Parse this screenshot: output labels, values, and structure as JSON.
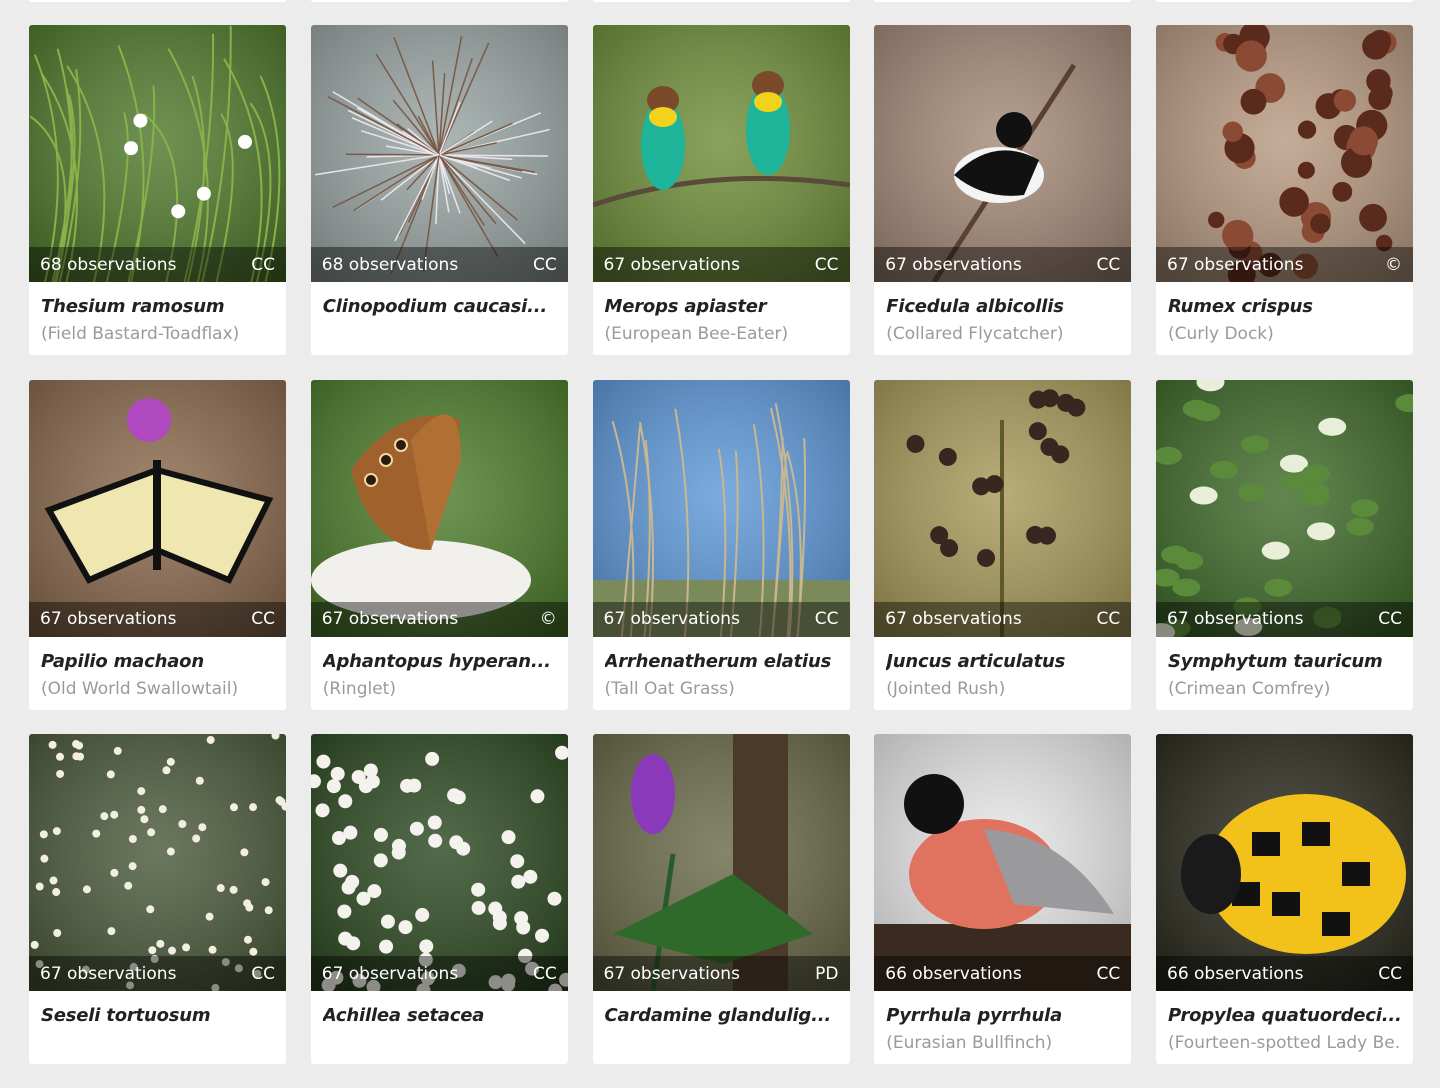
{
  "cards": [
    {
      "obs": "68 observations",
      "license": "CC",
      "sci": "Thesium ramosum",
      "common": "(Field Bastard-Toadflax)",
      "photo": "slender-green-stems-small-white-flowers",
      "bg": "#4f7a2c",
      "accent": "#ffffff"
    },
    {
      "obs": "68 observations",
      "license": "CC",
      "sci": "Clinopodium caucasi...",
      "common": "",
      "photo": "fluffy-white-seedhead",
      "bg": "#9aa6a4",
      "accent": "#e8e6ea"
    },
    {
      "obs": "67 observations",
      "license": "CC",
      "sci": "Merops apiaster",
      "common": "(European Bee-Eater)",
      "photo": "two-colorful-bee-eaters-on-branch",
      "bg": "#6f8f3a",
      "accent": "#1fb59a"
    },
    {
      "obs": "67 observations",
      "license": "CC",
      "sci": "Ficedula albicollis",
      "common": "(Collared Flycatcher)",
      "photo": "black-white-flycatcher-on-twig",
      "bg": "#a48a78",
      "accent": "#111111"
    },
    {
      "obs": "67 observations",
      "license": "©",
      "sci": "Rumex crispus",
      "common": "(Curly Dock)",
      "photo": "brown-dock-seed-cluster",
      "bg": "#b89a82",
      "accent": "#5a2a1c"
    },
    {
      "obs": "67 observations",
      "license": "CC",
      "sci": "Papilio machaon",
      "common": "(Old World Swallowtail)",
      "photo": "swallowtail-butterfly-on-thistle",
      "bg": "#8b6a4e",
      "accent": "#f0e6b0"
    },
    {
      "obs": "67 observations",
      "license": "©",
      "sci": "Aphantopus hyperan...",
      "common": "(Ringlet)",
      "photo": "brown-ringlet-butterfly-on-white-flowers",
      "bg": "#4d7d2c",
      "accent": "#a0612c"
    },
    {
      "obs": "67 observations",
      "license": "CC",
      "sci": "Arrhenatherum elatius",
      "common": "(Tall Oat Grass)",
      "photo": "oat-grass-against-blue-sky",
      "bg": "#5d98d8",
      "accent": "#c9b790"
    },
    {
      "obs": "67 observations",
      "license": "CC",
      "sci": "Juncus articulatus",
      "common": "(Jointed Rush)",
      "photo": "rush-seedheads-olive-background",
      "bg": "#a89a5a",
      "accent": "#3a2620"
    },
    {
      "obs": "67 observations",
      "license": "CC",
      "sci": "Symphytum tauricum",
      "common": "(Crimean Comfrey)",
      "photo": "green-comfrey-plant-white-flowers",
      "bg": "#3f6a2a",
      "accent": "#e8eed8"
    },
    {
      "obs": "67 observations",
      "license": "CC",
      "sci": "Seseli tortuosum",
      "common": "",
      "photo": "white-umbel-flowers-thin-stems",
      "bg": "#4a5a3a",
      "accent": "#f2efe2"
    },
    {
      "obs": "67 observations",
      "license": "CC",
      "sci": "Achillea setacea",
      "common": "",
      "photo": "white-yarrow-flower-cluster",
      "bg": "#2d4a22",
      "accent": "#f4f2ec"
    },
    {
      "obs": "67 observations",
      "license": "PD",
      "sci": "Cardamine glandulig...",
      "common": "",
      "photo": "purple-flower-forest-floor",
      "bg": "#6a6a4a",
      "accent": "#8a3ab8"
    },
    {
      "obs": "66 observations",
      "license": "CC",
      "sci": "Pyrrhula pyrrhula",
      "common": "(Eurasian Bullfinch)",
      "photo": "bullfinch-in-snow",
      "bg": "#e8e8ea",
      "accent": "#e07260"
    },
    {
      "obs": "66 observations",
      "license": "CC",
      "sci": "Propylea quatuordeci...",
      "common": "(Fourteen-spotted Lady Be...",
      "photo": "yellow-black-ladybird-beetle",
      "bg": "#2a2a1e",
      "accent": "#f2c21a"
    }
  ]
}
